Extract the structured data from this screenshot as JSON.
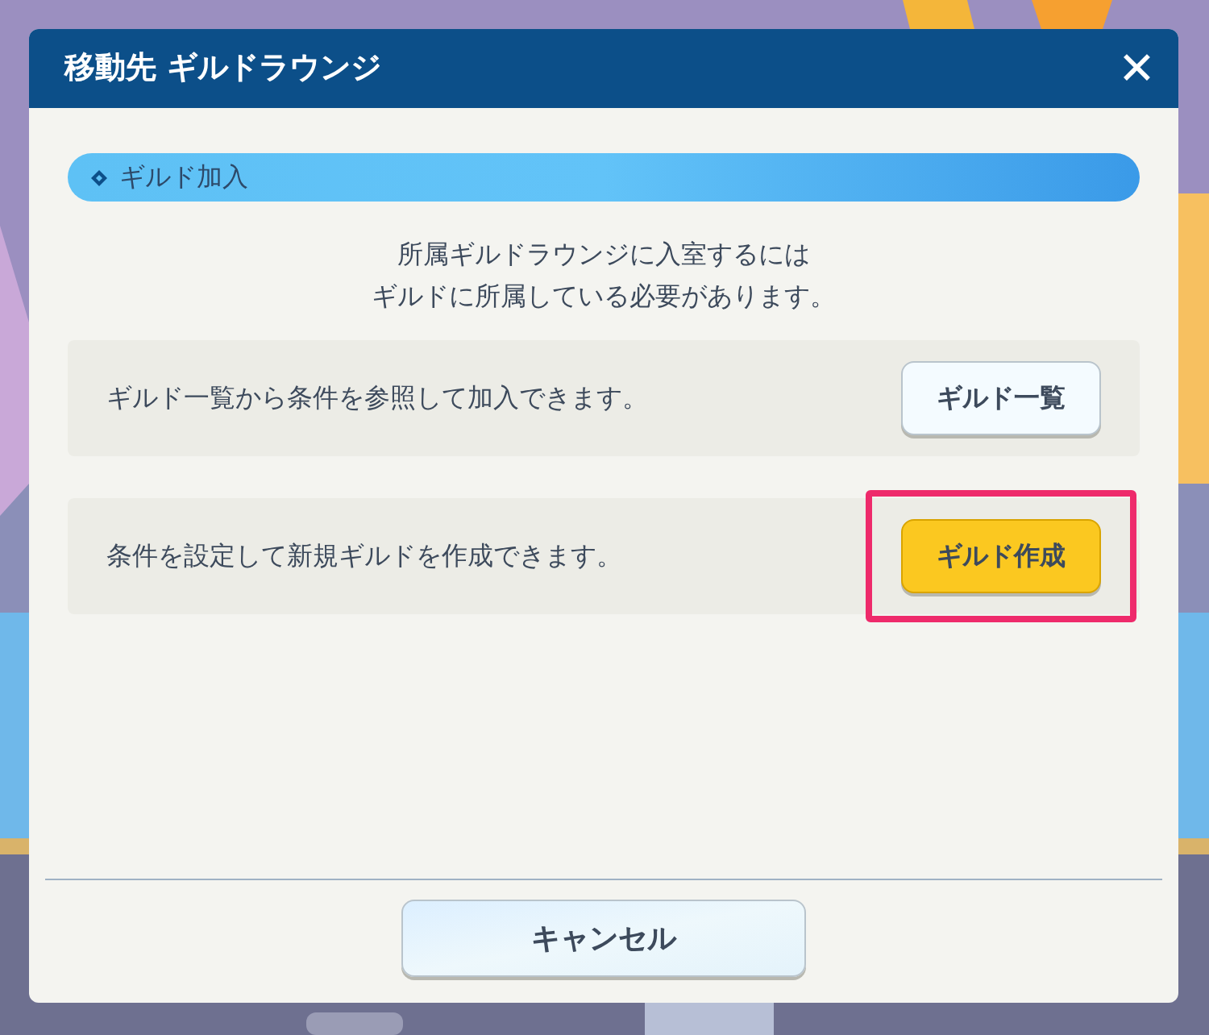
{
  "dialog": {
    "title": "移動先 ギルドラウンジ",
    "close_label": "✕"
  },
  "section": {
    "title": "ギルド加入"
  },
  "message": [
    "所属ギルドラウンジに入室するには",
    "ギルドに所属している必要があります。"
  ],
  "options": [
    {
      "description": "ギルド一覧から条件を参照して加入できます。",
      "button": "ギルド一覧",
      "kind": "normal",
      "highlighted": false
    },
    {
      "description": "条件を設定して新規ギルドを作成できます。",
      "button": "ギルド作成",
      "kind": "primary",
      "highlighted": true
    }
  ],
  "cancel_button": "キャンセル"
}
